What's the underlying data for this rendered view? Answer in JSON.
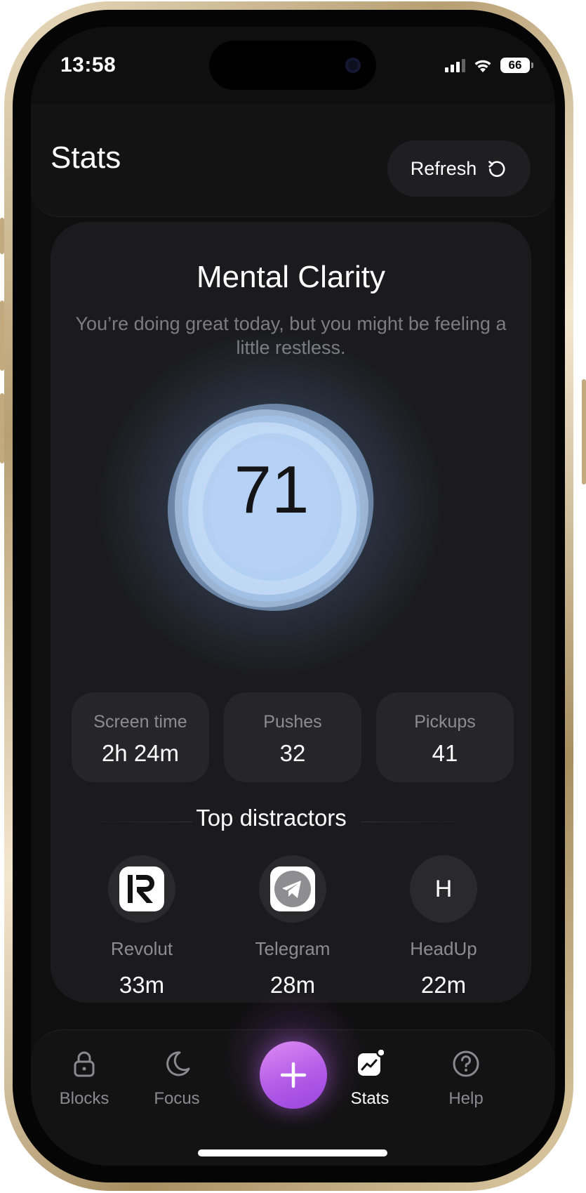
{
  "status_bar": {
    "time": "13:58",
    "battery": "66"
  },
  "header": {
    "title": "Stats",
    "refresh_label": "Refresh"
  },
  "clarity": {
    "title": "Mental Clarity",
    "subtitle": "You’re doing great today, but you might be feeling a little restless.",
    "score": "71"
  },
  "metrics": [
    {
      "label": "Screen time",
      "value": "2h 24m"
    },
    {
      "label": "Pushes",
      "value": "32"
    },
    {
      "label": "Pickups",
      "value": "41"
    }
  ],
  "distractors": {
    "title": "Top distractors",
    "items": [
      {
        "name": "Revolut",
        "time": "33m",
        "icon": "revolut-logo"
      },
      {
        "name": "Telegram",
        "time": "28m",
        "icon": "telegram-logo"
      },
      {
        "name": "HeadUp",
        "time": "22m",
        "icon": "H"
      }
    ]
  },
  "tabs": [
    {
      "label": "Blocks",
      "icon": "lock-icon"
    },
    {
      "label": "Focus",
      "icon": "moon-icon"
    },
    {
      "label": "Stats",
      "icon": "chart-icon",
      "active": true
    },
    {
      "label": "Help",
      "icon": "question-icon"
    }
  ],
  "colors": {
    "accent": "#b25be8",
    "background": "#0f0f10",
    "card": "#1b1b1d"
  }
}
